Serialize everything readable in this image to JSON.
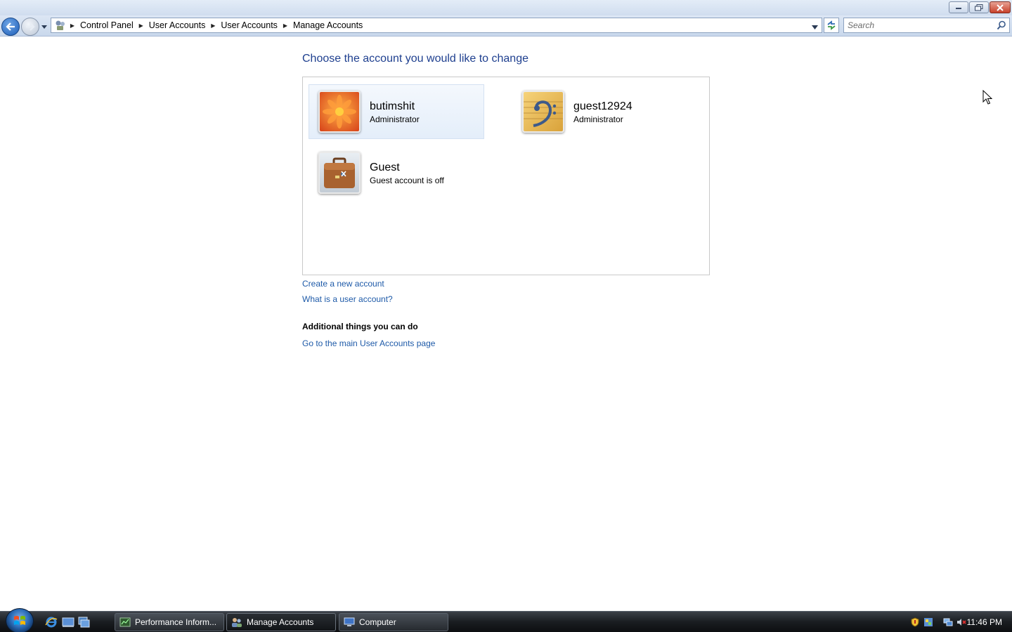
{
  "window": {
    "controls": [
      "minimize",
      "restore",
      "close"
    ]
  },
  "nav": {
    "breadcrumbs": [
      {
        "label": "Control Panel"
      },
      {
        "label": "User Accounts"
      },
      {
        "label": "User Accounts"
      },
      {
        "label": "Manage Accounts"
      }
    ],
    "search_placeholder": "Search"
  },
  "main": {
    "heading": "Choose the account you would like to change",
    "accounts": [
      {
        "name": "butimshit",
        "role": "Administrator",
        "picture": "orange-flower",
        "selected": true
      },
      {
        "name": "guest12924",
        "role": "Administrator",
        "picture": "bass-clef",
        "selected": false
      },
      {
        "name": "Guest",
        "role": "Guest account is off",
        "picture": "briefcase",
        "selected": false
      }
    ],
    "links": {
      "create": "Create a new account",
      "what_is": "What is a user account?"
    },
    "additional": {
      "heading": "Additional things you can do",
      "main_page_link": "Go to the main User Accounts page"
    }
  },
  "taskbar": {
    "tasks": [
      {
        "label": "Performance Inform...",
        "icon": "performance-icon",
        "active": false
      },
      {
        "label": "Manage Accounts",
        "icon": "users-icon",
        "active": true
      },
      {
        "label": "Computer",
        "icon": "computer-icon",
        "active": false
      }
    ],
    "clock": "11:46 PM"
  },
  "colors": {
    "heading": "#1e3f8f",
    "link": "#1e5aa8",
    "selected_tile": "#e4eefa"
  }
}
